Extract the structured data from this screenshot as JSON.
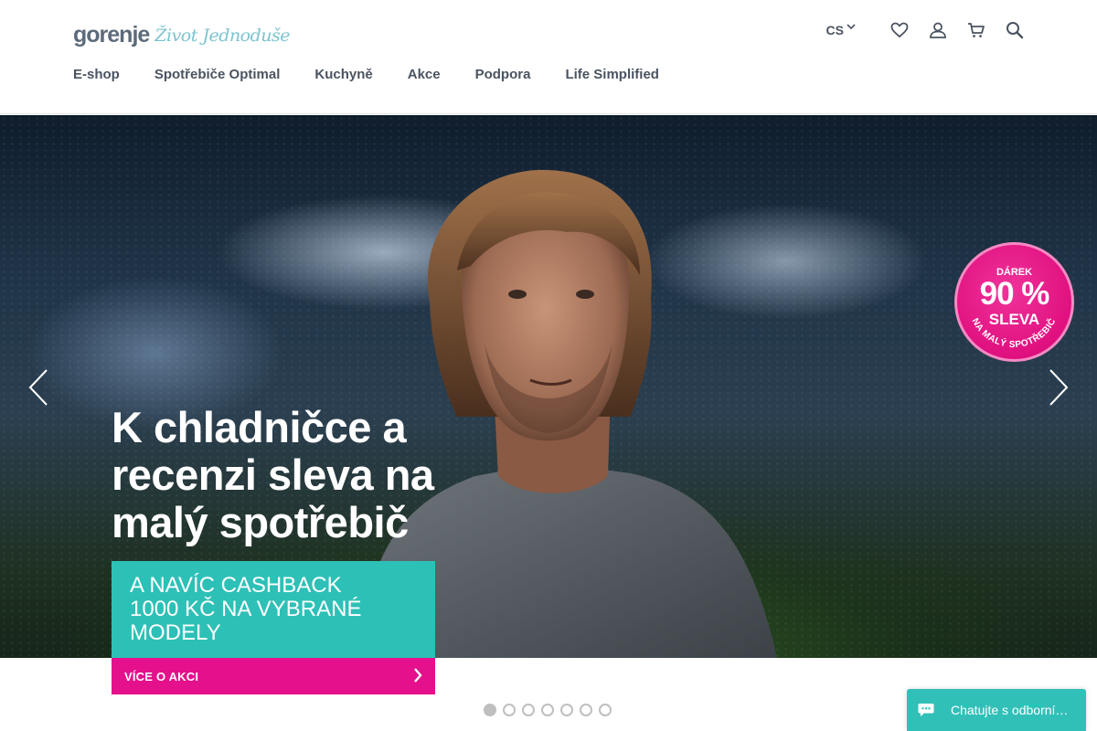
{
  "brand": {
    "logo_word": "gorenje",
    "logo_tagline": "Život Jednoduše"
  },
  "nav": {
    "items": [
      "E-shop",
      "Spotřebiče Optimal",
      "Kuchyně",
      "Akce",
      "Podpora",
      "Life Simplified"
    ]
  },
  "utils": {
    "language": "CS",
    "icons": [
      "chevron-down-icon",
      "heart-icon",
      "user-icon",
      "cart-icon",
      "search-icon"
    ]
  },
  "hero": {
    "headline": "K chladničce a recenzi sleva na malý spotřebič",
    "promo": "A NAVÍC CASHBACK 1000 KČ NA VYBRANÉ MODELY",
    "badge": {
      "top": "DÁREK",
      "big": "90 %",
      "mid": "SLEVA",
      "arc": "NA MALÝ SPOTŘEBIČ"
    },
    "cta_label": "VÍCE O AKCI"
  },
  "carousel": {
    "slide_count": 7,
    "active_index": 0
  },
  "chat": {
    "label": "Chatujte s odborní…"
  },
  "colors": {
    "teal": "#2dc0b7",
    "magenta": "#e5108b",
    "badge_pink": "#e0107f",
    "text_dark": "#4a5360"
  }
}
